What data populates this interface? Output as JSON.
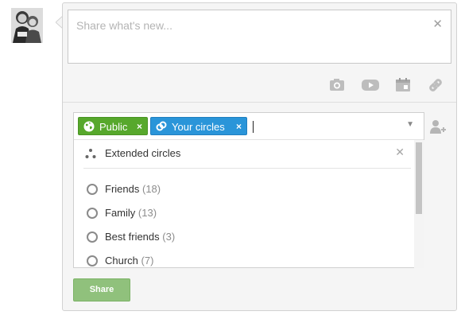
{
  "compose": {
    "placeholder": "Share what's new...",
    "close_icon": "close-icon"
  },
  "media_bar": {
    "icons": [
      "camera-icon",
      "video-icon",
      "calendar-icon",
      "link-icon"
    ]
  },
  "share_with": {
    "chips": [
      {
        "label": "Public",
        "icon": "globe-icon",
        "color": "#57a82c"
      },
      {
        "label": "Your circles",
        "icon": "circles-icon",
        "color": "#2a95d9"
      }
    ],
    "dropdown": {
      "extended": {
        "label": "Extended circles",
        "icon": "extended-circles-icon"
      },
      "circles": [
        {
          "name": "Friends",
          "count": "(18)"
        },
        {
          "name": "Family",
          "count": "(13)"
        },
        {
          "name": "Best friends",
          "count": "(3)"
        },
        {
          "name": "Church",
          "count": "(7)"
        }
      ]
    },
    "add_person_icon": "add-person-icon"
  },
  "actions": {
    "share_label": "Share",
    "share_color": "#90c17c"
  }
}
